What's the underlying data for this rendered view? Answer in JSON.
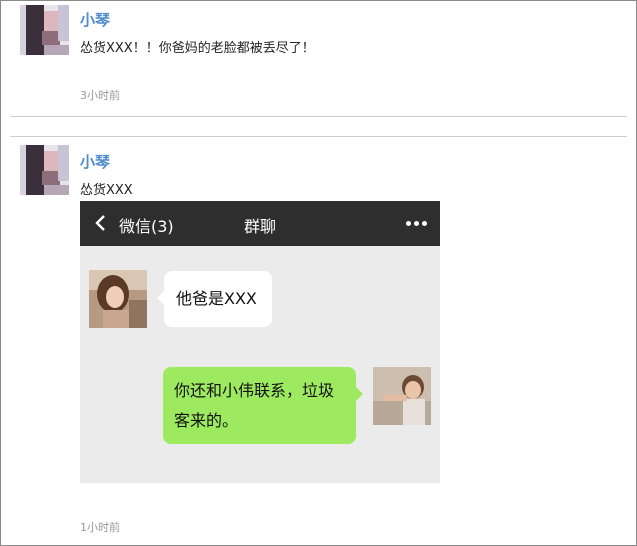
{
  "posts": [
    {
      "author": "小琴",
      "message": "怂货XXX！！你爸妈的老脸都被丢尽了！",
      "time": "3小时前"
    },
    {
      "author": "小琴",
      "message": "怂货XXX",
      "time": "1小时前",
      "attachment": {
        "topbar": {
          "back_icon": "chevron-left-icon",
          "back_label": "微信(3)",
          "title": "群聊",
          "more_icon": "ellipsis-icon"
        },
        "messages": [
          {
            "side": "left",
            "text": "他爸是XXX"
          },
          {
            "side": "right",
            "text": "你还和小伟联系，垃圾客来的。"
          }
        ]
      }
    }
  ],
  "colors": {
    "author_name": "#4f8bcd",
    "chat_topbar": "#2e2e2e",
    "chat_background": "#ebebeb",
    "bubble_incoming": "#ffffff",
    "bubble_outgoing": "#9de95f",
    "time_text": "#999999"
  }
}
